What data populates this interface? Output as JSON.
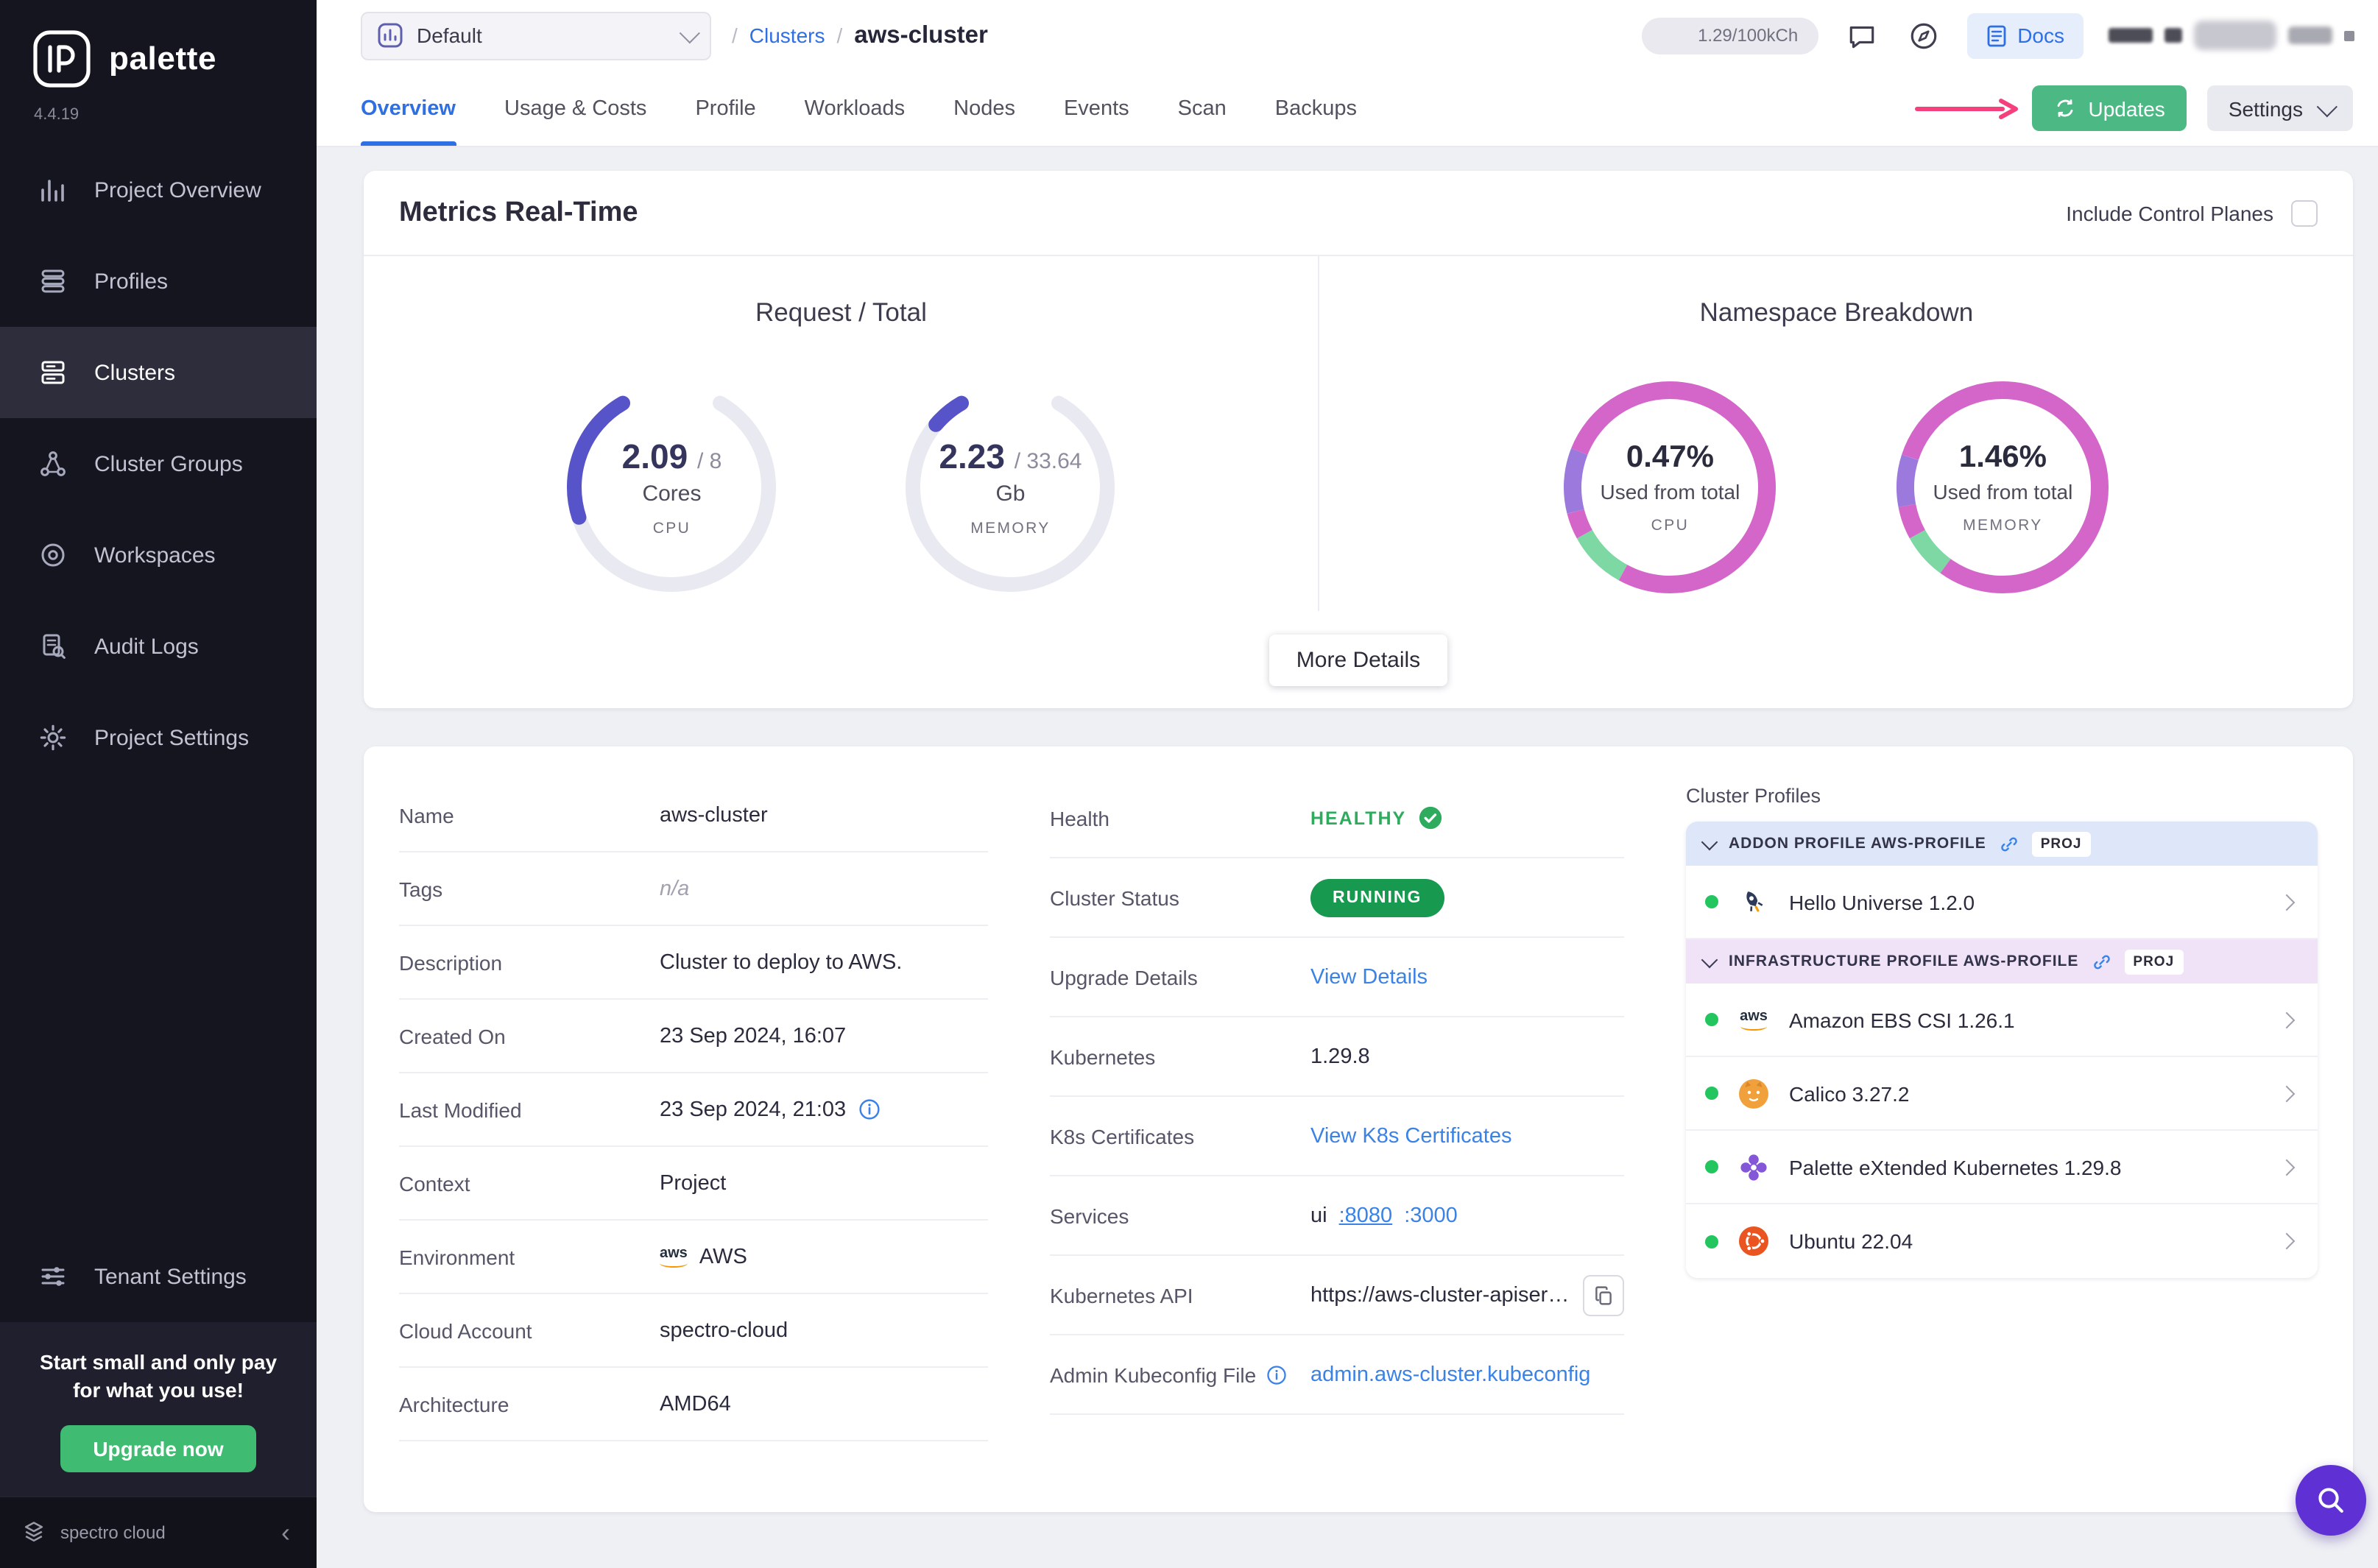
{
  "colors": {
    "accent_blue": "#2f6fe4",
    "link_blue": "#3b82e6",
    "updates_green": "#4cb985",
    "upgrade_green": "#3fbb72",
    "running_green": "#17994f",
    "healthy_green": "#2eab5d",
    "status_dot_green": "#22c55e",
    "arrow_pink": "#f4407d",
    "gauge_purple": "#5753c9",
    "fab_purple": "#5f31d4",
    "page_bg": "#eef0f4",
    "sidebar_bg": "#15151f",
    "sidebar_active_bg": "#2d2d3c",
    "promo_bg": "#1f1f2d",
    "addon_header_bg": "#dee6fa",
    "infra_header_bg": "#f0e3f8"
  },
  "sidebar": {
    "brand": "palette",
    "version": "4.4.19",
    "items": [
      {
        "label": "Project Overview"
      },
      {
        "label": "Profiles"
      },
      {
        "label": "Clusters"
      },
      {
        "label": "Cluster Groups"
      },
      {
        "label": "Workspaces"
      },
      {
        "label": "Audit Logs"
      },
      {
        "label": "Project Settings"
      }
    ],
    "tenant": "Tenant Settings",
    "promo_line1": "Start small and only pay",
    "promo_line2": "for what you use!",
    "upgrade": "Upgrade now",
    "footer": "spectro cloud"
  },
  "header": {
    "project": "Default",
    "crumb_section": "Clusters",
    "crumb_current": "aws-cluster",
    "usage": "1.29/100kCh",
    "docs": "Docs"
  },
  "tabs": {
    "items": [
      {
        "label": "Overview"
      },
      {
        "label": "Usage & Costs"
      },
      {
        "label": "Profile"
      },
      {
        "label": "Workloads"
      },
      {
        "label": "Nodes"
      },
      {
        "label": "Events"
      },
      {
        "label": "Scan"
      },
      {
        "label": "Backups"
      }
    ],
    "updates": "Updates",
    "settings": "Settings"
  },
  "metrics": {
    "title": "Metrics Real-Time",
    "include_toggle": "Include Control Planes",
    "request_total": {
      "title": "Request / Total",
      "gauges": [
        {
          "value": "2.09",
          "total": "/ 8",
          "unit": "Cores",
          "label": "CPU",
          "fraction": 0.26
        },
        {
          "value": "2.23",
          "total": "/ 33.64",
          "unit": "Gb",
          "label": "MEMORY",
          "fraction": 0.066
        }
      ]
    },
    "namespace": {
      "title": "Namespace Breakdown",
      "donuts": [
        {
          "value": "0.47%",
          "subtitle": "Used from total",
          "label": "CPU",
          "segments": [
            {
              "color": "#d466ca",
              "fraction": 0.58
            },
            {
              "color": "#7ed8a3",
              "fraction": 0.09
            },
            {
              "color": "#d466ca",
              "fraction": 0.04
            },
            {
              "color": "#9b79dd",
              "fraction": 0.1
            },
            {
              "color": "#d466ca",
              "fraction": 0.19
            }
          ]
        },
        {
          "value": "1.46%",
          "subtitle": "Used from total",
          "label": "MEMORY",
          "segments": [
            {
              "color": "#d466ca",
              "fraction": 0.6
            },
            {
              "color": "#7ed8a3",
              "fraction": 0.07
            },
            {
              "color": "#d466ca",
              "fraction": 0.05
            },
            {
              "color": "#9b79dd",
              "fraction": 0.08
            },
            {
              "color": "#d466ca",
              "fraction": 0.2
            }
          ]
        }
      ]
    },
    "more_details": "More Details"
  },
  "details": {
    "left": [
      {
        "label": "Name",
        "value": "aws-cluster"
      },
      {
        "label": "Tags",
        "value": "n/a"
      },
      {
        "label": "Description",
        "value": "Cluster to deploy to AWS."
      },
      {
        "label": "Created On",
        "value": "23 Sep 2024, 16:07"
      },
      {
        "label": "Last Modified",
        "value": "23 Sep 2024, 21:03"
      },
      {
        "label": "Context",
        "value": "Project"
      },
      {
        "label": "Environment",
        "value": "AWS"
      },
      {
        "label": "Cloud Account",
        "value": "spectro-cloud"
      },
      {
        "label": "Architecture",
        "value": "AMD64"
      }
    ],
    "middle": [
      {
        "label": "Health",
        "value": "HEALTHY"
      },
      {
        "label": "Cluster Status",
        "value": "RUNNING"
      },
      {
        "label": "Upgrade Details",
        "value": "View Details"
      },
      {
        "label": "Kubernetes",
        "value": "1.29.8"
      },
      {
        "label": "K8s Certificates",
        "value": "View K8s Certificates"
      },
      {
        "label": "Services",
        "value": "ui",
        "port1": ":8080",
        "port2": ":3000"
      },
      {
        "label": "Kubernetes API",
        "value": "https://aws-cluster-apiserve…"
      },
      {
        "label": "Admin Kubeconfig File",
        "value": "admin.aws-cluster.kubeconfig"
      }
    ]
  },
  "profiles": {
    "title": "Cluster Profiles",
    "groups": [
      {
        "header": "ADDON PROFILE AWS-PROFILE",
        "badge": "PROJ",
        "items": [
          {
            "name": "Hello Universe 1.2.0"
          }
        ]
      },
      {
        "header": "INFRASTRUCTURE PROFILE AWS-PROFILE",
        "badge": "PROJ",
        "items": [
          {
            "name": "Amazon EBS CSI 1.26.1"
          },
          {
            "name": "Calico 3.27.2"
          },
          {
            "name": "Palette eXtended Kubernetes 1.29.8"
          },
          {
            "name": "Ubuntu 22.04"
          }
        ]
      }
    ]
  }
}
